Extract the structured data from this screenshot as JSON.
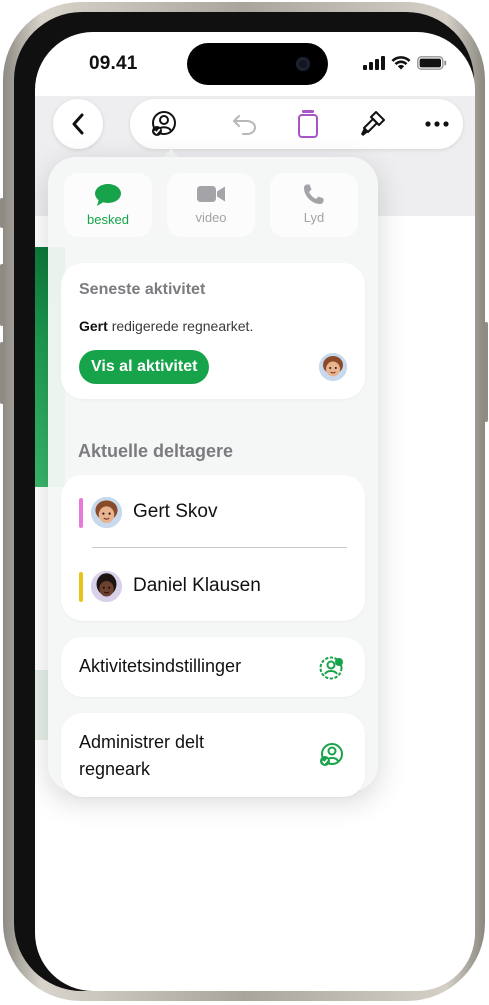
{
  "status": {
    "time": "09.41"
  },
  "toolbar": {
    "back_icon": "chevron-left-icon",
    "collaborate_icon": "person-check-icon",
    "undo_icon": "undo-icon",
    "copy_icon": "copy-icon",
    "format_icon": "paintbrush-icon",
    "more_icon": "ellipsis-icon"
  },
  "popover": {
    "media": [
      {
        "label": "besked",
        "icon": "message-bubble-icon",
        "color": "#16a34a"
      },
      {
        "label": "video",
        "icon": "video-camera-icon",
        "color": "#a3a3a8"
      },
      {
        "label": "Lyd",
        "icon": "phone-icon",
        "color": "#a3a3a8"
      }
    ],
    "activity": {
      "title": "Seneste aktivitet",
      "user": "Gert",
      "action": "redigerede regnearket.",
      "button": "Vis al aktivitet"
    },
    "participants_title": "Aktuelle deltagere",
    "participants": [
      {
        "name": "Gert Skov",
        "color": "#e879d9"
      },
      {
        "name": "Daniel Klausen",
        "color": "#e8c419"
      }
    ],
    "settings_label": "Aktivitetsindstillinger",
    "manage_label_line1": "Administrer delt",
    "manage_label_line2": "regneark"
  },
  "colors": {
    "accent": "#16a34a",
    "panel": "#f4f7f5"
  }
}
